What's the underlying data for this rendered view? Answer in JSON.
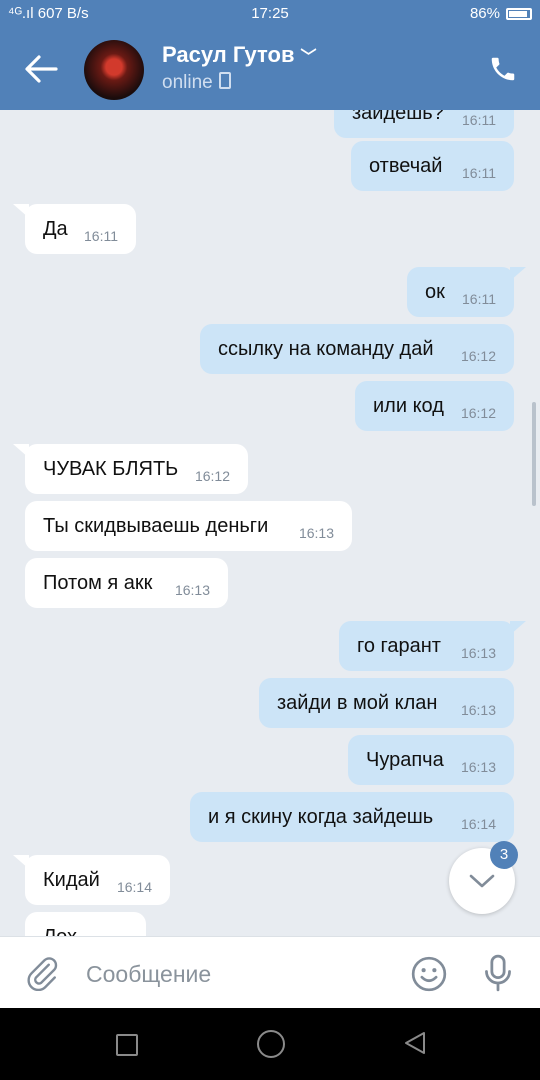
{
  "status_bar": {
    "left": "⁴ᴳ.ıl 607 B/s",
    "time": "17:25",
    "right": "86%"
  },
  "header": {
    "name": "Расул Гутов",
    "status": "online"
  },
  "messages": [
    {
      "dir": "out",
      "text": "зайдешь?",
      "time": "16:11"
    },
    {
      "dir": "out",
      "text": "отвечай",
      "time": "16:11"
    },
    {
      "dir": "in",
      "text": "Да",
      "time": "16:11"
    },
    {
      "dir": "out",
      "text": "ок",
      "time": "16:11"
    },
    {
      "dir": "out",
      "text": "ссылку на команду дай",
      "time": "16:12"
    },
    {
      "dir": "out",
      "text": "или код",
      "time": "16:12"
    },
    {
      "dir": "in",
      "text": "ЧУВАК БЛЯТЬ",
      "time": "16:12"
    },
    {
      "dir": "in",
      "text": "Ты скидвываешь деньги",
      "time": "16:13"
    },
    {
      "dir": "in",
      "text": "Потом я акк",
      "time": "16:13"
    },
    {
      "dir": "out",
      "text": "го гарант",
      "time": "16:13"
    },
    {
      "dir": "out",
      "text": "зайди в мой клан",
      "time": "16:13"
    },
    {
      "dir": "out",
      "text": "Чурапча",
      "time": "16:13"
    },
    {
      "dir": "out",
      "text": "и я скину когда зайдешь",
      "time": "16:14"
    },
    {
      "dir": "in",
      "text": "Кидай",
      "time": "16:14"
    },
    {
      "dir": "in",
      "text": "Лох",
      "time": ""
    }
  ],
  "scroll_badge": "3",
  "input": {
    "placeholder": "Сообщение"
  },
  "icons": {
    "back": "arrow-left-icon",
    "call": "phone-icon",
    "attach": "paperclip-icon",
    "emoji": "smile-icon",
    "voice": "microphone-icon"
  },
  "colors": {
    "header": "#5181b8",
    "outgoing": "#cce4f7",
    "incoming": "#ffffff",
    "background": "#e8ecf1"
  }
}
